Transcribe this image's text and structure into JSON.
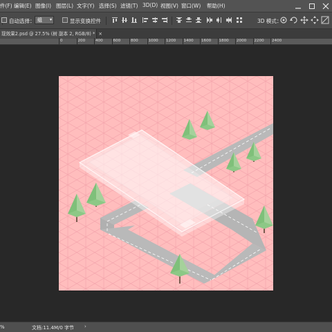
{
  "app": {
    "menu": [
      {
        "label": "件(F)"
      },
      {
        "label": "编辑(E)"
      },
      {
        "label": "图像(I)"
      },
      {
        "label": "图层(L)"
      },
      {
        "label": "文字(Y)"
      },
      {
        "label": "选择(S)"
      },
      {
        "label": "滤镜(T)"
      },
      {
        "label": "3D(D)"
      },
      {
        "label": "视图(V)"
      },
      {
        "label": "窗口(W)"
      },
      {
        "label": "帮助(H)"
      }
    ]
  },
  "options": {
    "auto_select_label": "自动选择：",
    "auto_select_value": "组",
    "show_transform_label": "显示变换控件",
    "mode_3d_label": "3D 模式："
  },
  "document": {
    "tab_title": "现效果2.psd @ 27.5% (树 副本 2, RGB/8) *",
    "tab_close": "×",
    "background_color": "#ffbdbd"
  },
  "ruler": {
    "ticks": [
      "0",
      "200",
      "400",
      "600",
      "800",
      "1000",
      "1200",
      "1400",
      "1600",
      "1800",
      "2000",
      "2200",
      "2400"
    ]
  },
  "status": {
    "zoom": "%",
    "doc_info": "文档:11.4M/0 字节",
    "arrow": "›"
  }
}
